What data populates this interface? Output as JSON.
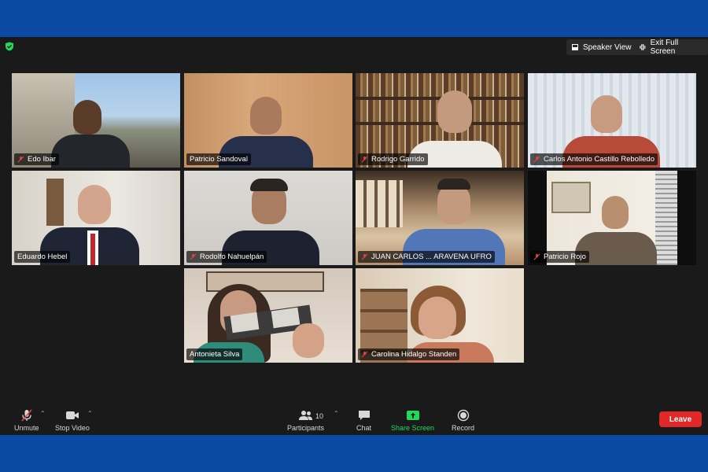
{
  "top_bar": {
    "speaker_view_label": "Speaker View",
    "exit_full_screen_label": "Exit Full Screen"
  },
  "participants": [
    {
      "name": "Edo Ibar",
      "muted": true,
      "active": false
    },
    {
      "name": "Patricio Sandoval",
      "muted": false,
      "active": false
    },
    {
      "name": "Rodrigo Garrido",
      "muted": true,
      "active": false
    },
    {
      "name": "Carlos Antonio Castillo Rebolledo",
      "muted": true,
      "active": false
    },
    {
      "name": "Eduardo Hebel",
      "muted": false,
      "active": false
    },
    {
      "name": "Rodolfo Nahuelpán",
      "muted": true,
      "active": false
    },
    {
      "name": "JUAN CARLOS ... ARAVENA UFRO",
      "muted": true,
      "active": false
    },
    {
      "name": "Patricio Rojo",
      "muted": true,
      "active": false
    },
    {
      "name": "Antonieta Silva",
      "muted": false,
      "active": true
    },
    {
      "name": "Carolina Hidalgo Standen",
      "muted": true,
      "active": false
    }
  ],
  "toolbar": {
    "unmute_label": "Unmute",
    "stop_video_label": "Stop Video",
    "participants_label": "Participants",
    "participants_count": "10",
    "chat_label": "Chat",
    "share_screen_label": "Share Screen",
    "record_label": "Record",
    "leave_label": "Leave"
  },
  "colors": {
    "frame_blue": "#0b4aa3",
    "app_bg": "#1a1a1a",
    "active_speaker": "#23d959",
    "share_green": "#23d959",
    "leave_red": "#e02828",
    "mute_red": "#e0454a"
  }
}
